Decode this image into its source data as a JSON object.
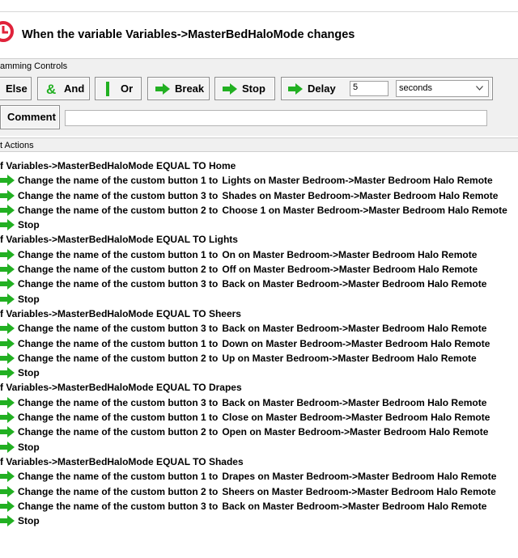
{
  "header": {
    "title": "When the variable Variables->MasterBedHaloMode changes"
  },
  "sections": {
    "programming_controls": "amming Controls",
    "actions": "t Actions"
  },
  "controls": {
    "else_label": "Else",
    "and_label": "And",
    "or_label": "Or",
    "break_label": "Break",
    "stop_label": "Stop",
    "delay_label": "Delay",
    "delay_value": "5",
    "delay_unit": "seconds",
    "comment_label": "Comment",
    "comment_value": ""
  },
  "colors": {
    "green_arrow": "#22b022",
    "logo_red": "#e0223a"
  },
  "actions": [
    {
      "type": "cond",
      "text": "f Variables->MasterBedHaloMode EQUAL TO Home"
    },
    {
      "type": "act",
      "cmd": "Change the name of the custom button 1 to",
      "target": "Lights on Master Bedroom->Master Bedroom Halo Remote"
    },
    {
      "type": "act",
      "cmd": "Change the name of the custom button 3 to",
      "target": "Shades on Master Bedroom->Master Bedroom Halo Remote"
    },
    {
      "type": "act",
      "cmd": "Change the name of the custom button 2 to",
      "target": "Choose 1 on Master Bedroom->Master Bedroom Halo Remote"
    },
    {
      "type": "act",
      "cmd": "Stop",
      "target": ""
    },
    {
      "type": "cond",
      "text": "f Variables->MasterBedHaloMode EQUAL TO Lights"
    },
    {
      "type": "act",
      "cmd": "Change the name of the custom button 1 to",
      "target": "On on Master Bedroom->Master Bedroom Halo Remote"
    },
    {
      "type": "act",
      "cmd": "Change the name of the custom button 2 to",
      "target": "Off on Master Bedroom->Master Bedroom Halo Remote"
    },
    {
      "type": "act",
      "cmd": "Change the name of the custom button 3 to",
      "target": "Back on Master Bedroom->Master Bedroom Halo Remote"
    },
    {
      "type": "act",
      "cmd": "Stop",
      "target": ""
    },
    {
      "type": "cond",
      "text": "f Variables->MasterBedHaloMode EQUAL TO Sheers"
    },
    {
      "type": "act",
      "cmd": "Change the name of the custom button 3 to",
      "target": "Back on Master Bedroom->Master Bedroom Halo Remote"
    },
    {
      "type": "act",
      "cmd": "Change the name of the custom button 1 to",
      "target": "Down on Master Bedroom->Master Bedroom Halo Remote"
    },
    {
      "type": "act",
      "cmd": "Change the name of the custom button 2 to",
      "target": "Up on Master Bedroom->Master Bedroom Halo Remote"
    },
    {
      "type": "act",
      "cmd": "Stop",
      "target": ""
    },
    {
      "type": "cond",
      "text": "f Variables->MasterBedHaloMode EQUAL TO Drapes"
    },
    {
      "type": "act",
      "cmd": "Change the name of the custom button 3 to",
      "target": "Back on Master Bedroom->Master Bedroom Halo Remote"
    },
    {
      "type": "act",
      "cmd": "Change the name of the custom button 1 to",
      "target": "Close on Master Bedroom->Master Bedroom Halo Remote"
    },
    {
      "type": "act",
      "cmd": "Change the name of the custom button 2 to",
      "target": "Open on Master Bedroom->Master Bedroom Halo Remote"
    },
    {
      "type": "act",
      "cmd": "Stop",
      "target": ""
    },
    {
      "type": "cond",
      "text": "f Variables->MasterBedHaloMode EQUAL TO Shades"
    },
    {
      "type": "act",
      "cmd": "Change the name of the custom button 1 to",
      "target": "Drapes on Master Bedroom->Master Bedroom Halo Remote"
    },
    {
      "type": "act",
      "cmd": "Change the name of the custom button 2 to",
      "target": "Sheers on Master Bedroom->Master Bedroom Halo Remote"
    },
    {
      "type": "act",
      "cmd": "Change the name of the custom button 3 to",
      "target": "Back on Master Bedroom->Master Bedroom Halo Remote"
    },
    {
      "type": "act",
      "cmd": "Stop",
      "target": ""
    }
  ]
}
